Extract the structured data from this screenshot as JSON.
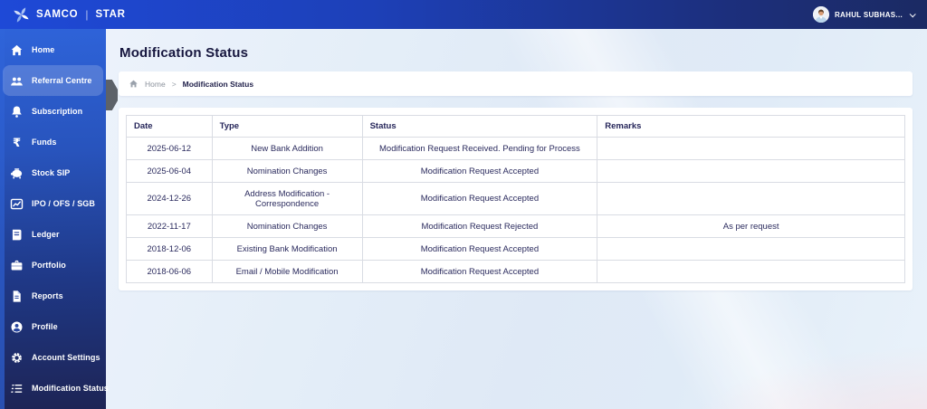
{
  "topbar": {
    "brand_name": "SAMCO",
    "brand_divider": "|",
    "brand_product": "STAR",
    "logo_icon": "samco-pinwheel",
    "user_name": "RAHUL SUBHAS...",
    "user_chevron_icon": "chevron-down"
  },
  "sidebar": {
    "items": [
      {
        "label": "Home",
        "icon": "home",
        "active": false
      },
      {
        "label": "Referral Centre",
        "icon": "referral-people",
        "active": true
      },
      {
        "label": "Subscription",
        "icon": "bell",
        "active": false
      },
      {
        "label": "Funds",
        "icon": "rupee",
        "active": false
      },
      {
        "label": "Stock SIP",
        "icon": "piggy-bank",
        "active": false
      },
      {
        "label": "IPO / OFS / SGB",
        "icon": "line-chart",
        "active": false
      },
      {
        "label": "Ledger",
        "icon": "book",
        "active": false
      },
      {
        "label": "Portfolio",
        "icon": "briefcase",
        "active": false
      },
      {
        "label": "Reports",
        "icon": "document",
        "active": false
      },
      {
        "label": "Profile",
        "icon": "person-circle",
        "active": false
      },
      {
        "label": "Account Settings",
        "icon": "gear",
        "active": false
      },
      {
        "label": "Modification Status",
        "icon": "checklist",
        "active": false
      }
    ]
  },
  "page": {
    "title": "Modification Status"
  },
  "breadcrumb": {
    "home_icon": "home",
    "home": "Home",
    "separator": ">",
    "current": "Modification Status"
  },
  "table": {
    "headers": [
      "Date",
      "Type",
      "Status",
      "Remarks"
    ],
    "column_widths": [
      "11%",
      "19.3%",
      "30.2%",
      "39.5%"
    ],
    "rows": [
      [
        "2025-06-12",
        "New Bank Addition",
        "Modification Request Received. Pending for Process",
        ""
      ],
      [
        "2025-06-04",
        "Nomination Changes",
        "Modification Request Accepted",
        ""
      ],
      [
        "2024-12-26",
        "Address Modification - Correspondence",
        "Modification Request Accepted",
        ""
      ],
      [
        "2022-11-17",
        "Nomination Changes",
        "Modification Request Rejected",
        "As per request"
      ],
      [
        "2018-12-06",
        "Existing Bank Modification",
        "Modification Request Accepted",
        ""
      ],
      [
        "2018-06-06",
        "Email / Mobile Modification",
        "Modification Request Accepted",
        ""
      ]
    ]
  },
  "colors": {
    "topbar_gradient_start": "#1e49d7",
    "topbar_gradient_end": "#1b2a63",
    "sidebar_gradient_top": "#2e63d9",
    "sidebar_gradient_bottom": "#1d2455",
    "active_item_highlight": "rgba(255,255,255,0.18)",
    "text_dark": "#2b2b5e",
    "breadcrumb_muted": "#8b929c",
    "card_background": "#ffffff"
  }
}
